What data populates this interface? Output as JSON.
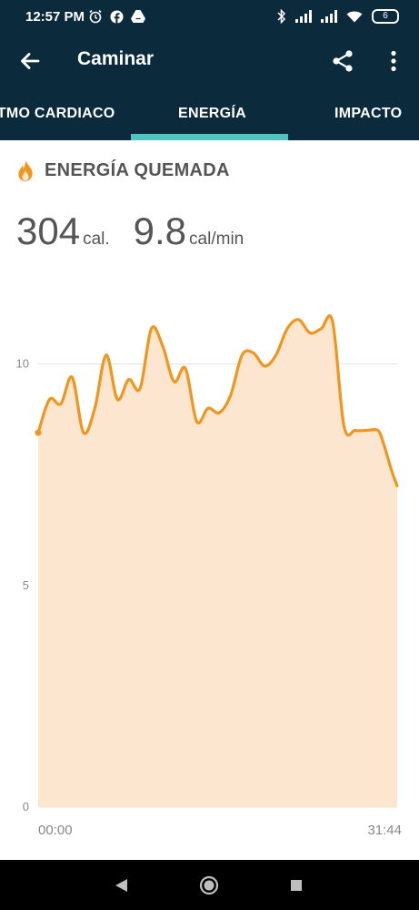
{
  "status_bar": {
    "time": "12:57 PM",
    "left_icons": [
      "alarm-icon",
      "facebook-icon",
      "drive-icon"
    ],
    "right_icons": [
      "bluetooth-icon",
      "signal-icon",
      "signal-icon",
      "wifi-icon"
    ],
    "battery": "6"
  },
  "app_bar": {
    "title": "Caminar",
    "back_icon": "arrow-back-icon",
    "share_icon": "share-icon",
    "more_icon": "more-vert-icon"
  },
  "tabs": [
    {
      "label": "ITMO CARDIACO",
      "active": false
    },
    {
      "label": "ENERGÍA",
      "active": true
    },
    {
      "label": "IMPACTO",
      "active": false
    }
  ],
  "section": {
    "icon": "flame-icon",
    "title": "ENERGÍA QUEMADA"
  },
  "metrics": {
    "total_value": "304",
    "total_unit": "cal.",
    "rate_value": "9.8",
    "rate_unit": "cal/min"
  },
  "chart_data": {
    "type": "area",
    "y_ticks": [
      "0",
      "5",
      "10"
    ],
    "ylim": [
      0,
      11.8
    ],
    "x_labels": [
      "00:00",
      "31:44"
    ],
    "grid": true,
    "colors": {
      "line": "#f0961e",
      "fill": "#fde6cf",
      "grid": "#e2e2e2"
    },
    "x": [
      0,
      1,
      2,
      3,
      4,
      5,
      6,
      7,
      8,
      9,
      10,
      11,
      12,
      13,
      14,
      15,
      16,
      17,
      18,
      19,
      20,
      21,
      22,
      23,
      24,
      25,
      26,
      27,
      28,
      29,
      30,
      30.5,
      31.2,
      31.7
    ],
    "values": [
      8.45,
      9.2,
      9.1,
      9.7,
      8.45,
      9.0,
      10.2,
      9.2,
      9.65,
      9.45,
      10.8,
      10.4,
      9.6,
      9.9,
      8.7,
      9.0,
      8.9,
      9.3,
      10.2,
      10.25,
      9.95,
      10.2,
      10.8,
      11.0,
      10.7,
      10.8,
      10.95,
      8.6,
      8.5,
      8.5,
      8.5,
      8.2,
      7.6,
      7.25
    ]
  }
}
